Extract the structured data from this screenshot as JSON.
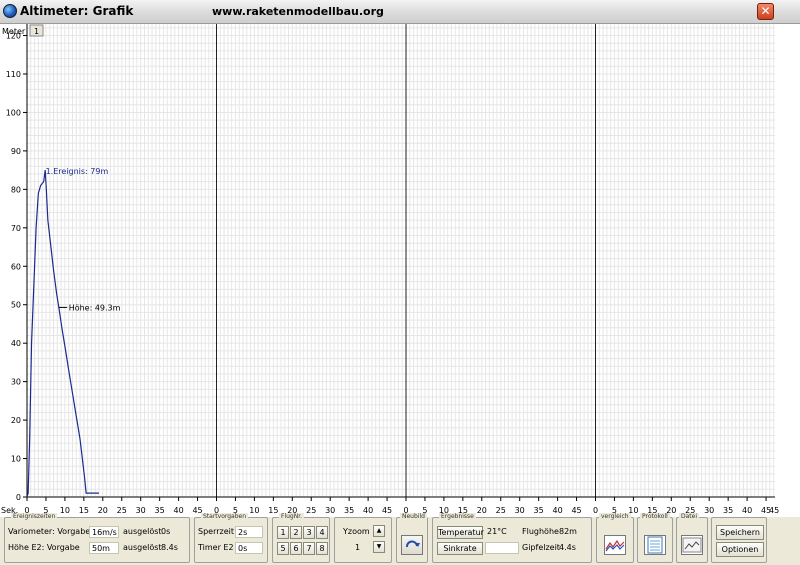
{
  "window": {
    "title": "Altimeter: Grafik",
    "url": "www.raketenmodellbau.org",
    "close_symbol": "✕"
  },
  "graph": {
    "y_unit": "Meter",
    "tab": "1",
    "x_unit": "Sek.",
    "y_ticks": [
      "0",
      "10",
      "20",
      "30",
      "40",
      "50",
      "60",
      "70",
      "80",
      "90",
      "100",
      "110",
      "120"
    ],
    "x_tick_labels": [
      "0",
      "5",
      "10",
      "15",
      "20",
      "25",
      "30",
      "35",
      "40",
      "45"
    ],
    "x_tick_labels_last": [
      "0",
      "5",
      "10",
      "15",
      "20",
      "25",
      "30",
      "35",
      "40",
      "45"
    ],
    "event_annotation": "1.Ereignis: 79m",
    "height_annotation": "Höhe: 49.3m",
    "line_color": "#1a2a8c"
  },
  "chart_data": {
    "type": "line",
    "xlabel": "Sek.",
    "ylabel": "Meter",
    "ylim": [
      0,
      123
    ],
    "xlim": [
      0,
      50
    ],
    "series": [
      {
        "values": [
          [
            0,
            0
          ],
          [
            0.3,
            1
          ],
          [
            0.7,
            15
          ],
          [
            1.2,
            40
          ],
          [
            1.8,
            55
          ],
          [
            2.4,
            70
          ],
          [
            3.0,
            79
          ],
          [
            3.6,
            81
          ],
          [
            4.4,
            82
          ],
          [
            4.8,
            85
          ],
          [
            5.1,
            80
          ],
          [
            5.5,
            72
          ],
          [
            6.2,
            66
          ],
          [
            7.0,
            59
          ],
          [
            7.8,
            53
          ],
          [
            8.4,
            49.3
          ],
          [
            9.2,
            44
          ],
          [
            10.2,
            38
          ],
          [
            11.0,
            33
          ],
          [
            12.0,
            27
          ],
          [
            13.0,
            21
          ],
          [
            14.0,
            15
          ],
          [
            14.6,
            10
          ],
          [
            15.2,
            5
          ],
          [
            15.6,
            1
          ],
          [
            16.5,
            1
          ],
          [
            19.0,
            1
          ]
        ]
      }
    ],
    "grid": true
  },
  "footer": {
    "ereigniszeiten": {
      "title": "Ereigniszeiten",
      "row1_label": "Variometer: Vorgabe",
      "row1_value": "16m/s",
      "row1_trigger": "ausgelöst",
      "row1_trigger_value": "0s",
      "row2_label": "Höhe E2:  Vorgabe",
      "row2_value": "50m",
      "row2_trigger": "ausgelöst",
      "row2_trigger_value": "8.4s"
    },
    "startvorgaben": {
      "title": "Startvorgaben",
      "row1_label": "Sperrzeit",
      "row1_value": "2s",
      "row2_label": "Timer E2",
      "row2_value": "0s"
    },
    "flugnr": {
      "title": "FlugNr.",
      "buttons": [
        "1",
        "2",
        "3",
        "4",
        "5",
        "6",
        "7",
        "8"
      ]
    },
    "yzoom": {
      "label": "Yzoom",
      "value": "1",
      "up": "▲",
      "down": "▼"
    },
    "neubild": {
      "title": "Neubild"
    },
    "ergebnisse": {
      "title": "Ergebnisse",
      "temperature_label": "Temperatur",
      "temperature_value": "21°C",
      "sinkrate_label": "Sinkrate",
      "sinkrate_value": "",
      "flughoehe_label": "Flughöhe",
      "flughoehe_value": "82m",
      "gipfelzeit_label": "Gipfelzeit",
      "gipfelzeit_value": "4.4s"
    },
    "vergleich": {
      "title": "vergleich"
    },
    "protokoll": {
      "title": "Protokoll"
    },
    "datei": {
      "title": "Datei"
    },
    "speichern": {
      "label": "Speichern"
    },
    "optionen": {
      "label": "Optionen"
    }
  }
}
